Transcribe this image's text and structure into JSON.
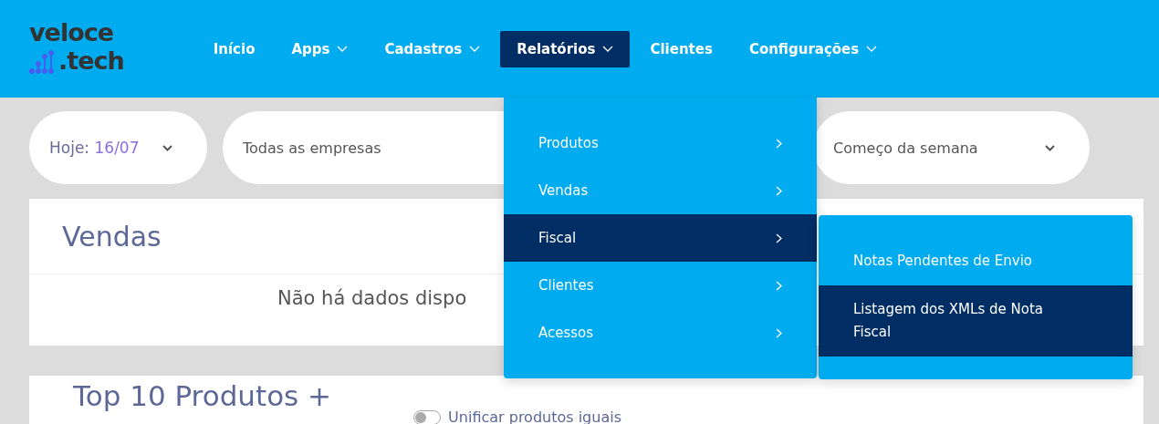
{
  "logo": {
    "line_1": "veloce",
    "line_2": ".tech"
  },
  "nav": [
    {
      "label": "Início",
      "caret": false,
      "selected": false
    },
    {
      "label": "Apps",
      "caret": true,
      "selected": false
    },
    {
      "label": "Cadastros",
      "caret": true,
      "selected": false
    },
    {
      "label": "Relatórios",
      "caret": true,
      "selected": true
    },
    {
      "label": "Clientes",
      "caret": false,
      "selected": false
    },
    {
      "label": "Configurações",
      "caret": true,
      "selected": false
    }
  ],
  "filters": {
    "date_label": "Hoje:",
    "date_value": "16/07",
    "company": "Todas as empresas",
    "period": "Começo da semana"
  },
  "sales_card": {
    "title": "Vendas",
    "message": "Não há dados dispo"
  },
  "top_card": {
    "title": "Top 10 Produtos +",
    "toggle_label": "Unificar produtos iguais",
    "toggle_on": false
  },
  "menu": [
    {
      "label": "Produtos",
      "selected": false
    },
    {
      "label": "Vendas",
      "selected": false
    },
    {
      "label": "Fiscal",
      "selected": true
    },
    {
      "label": "Clientes",
      "selected": false
    },
    {
      "label": "Acessos",
      "selected": false
    }
  ],
  "submenu": [
    {
      "label": "Notas Pendentes de Envio",
      "selected": false
    },
    {
      "label": "Listagem dos XMLs de Nota Fiscal",
      "selected": true
    }
  ]
}
